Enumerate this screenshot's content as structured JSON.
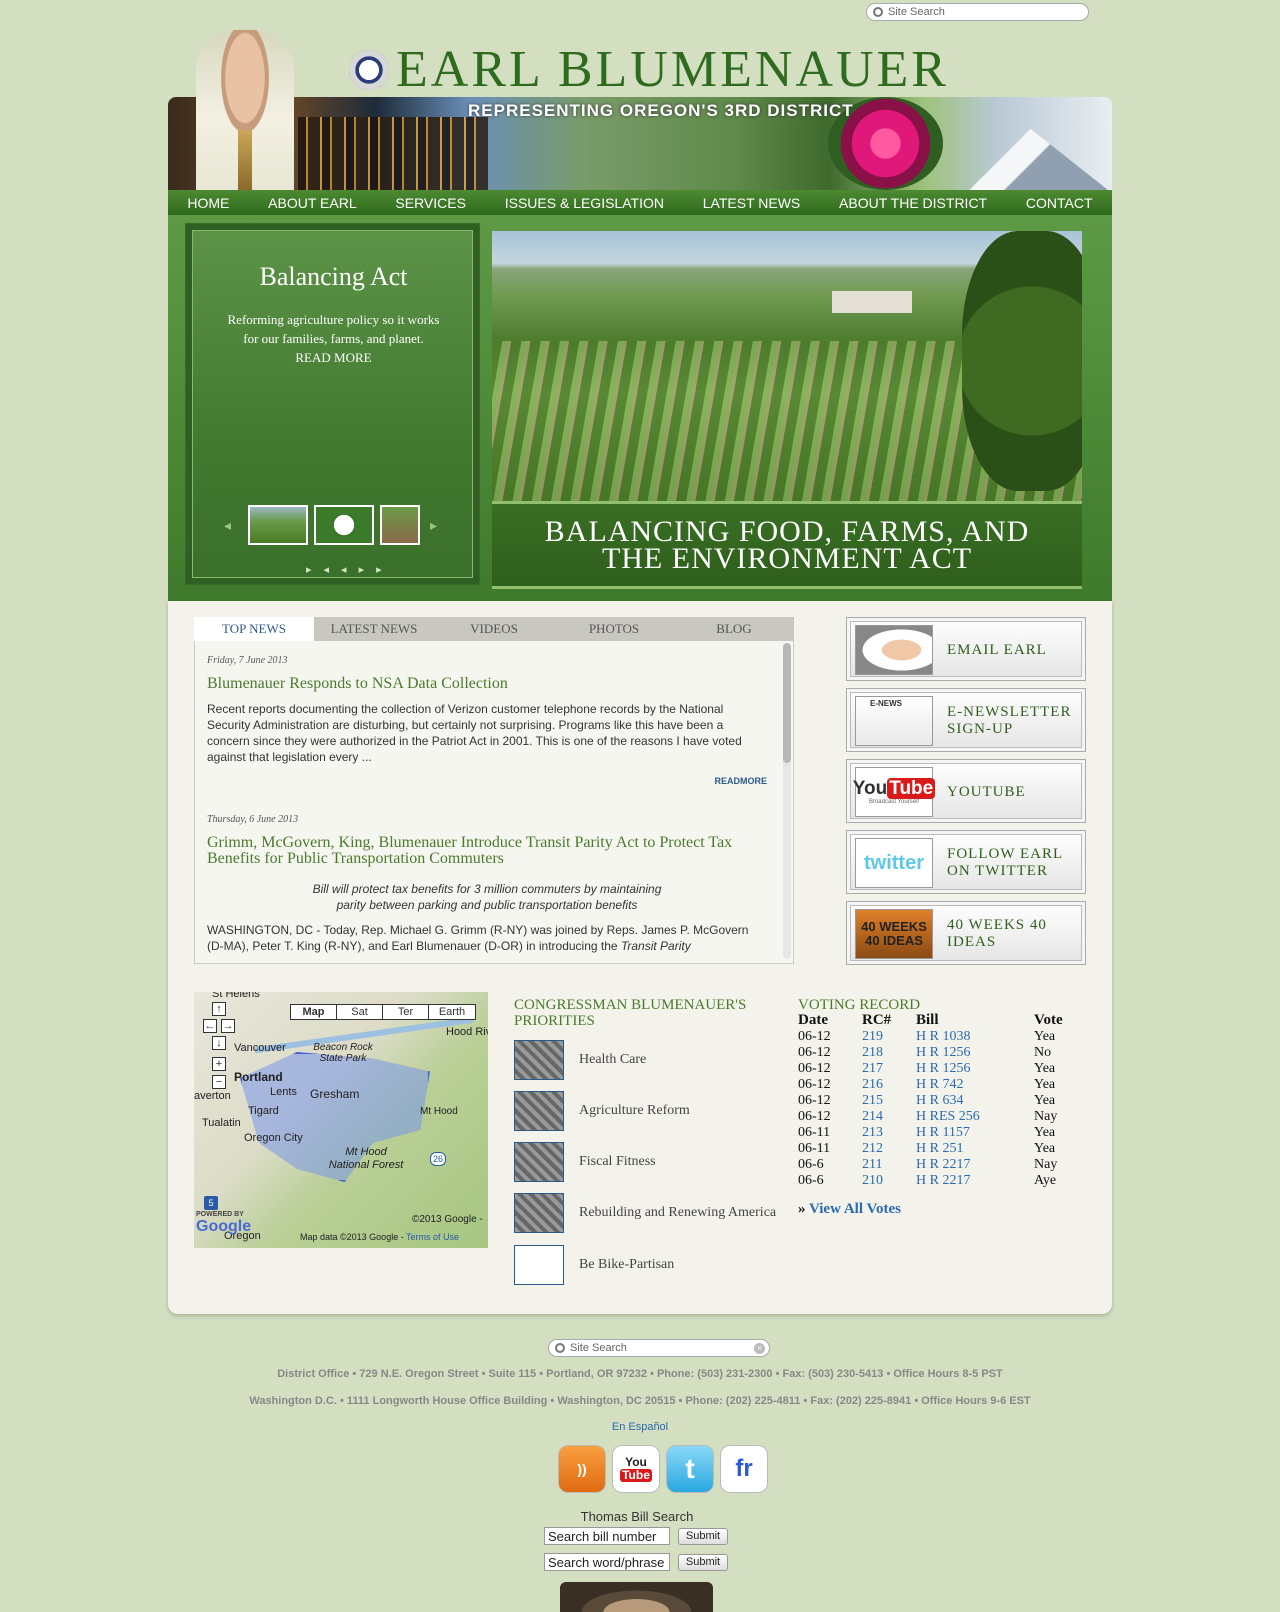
{
  "header": {
    "search_placeholder": "Site Search",
    "title": "EARL BLUMENAUER",
    "banner_text": "REPRESENTING OREGON'S 3RD DISTRICT"
  },
  "nav": [
    "HOME",
    "ABOUT EARL",
    "SERVICES",
    "ISSUES & LEGISLATION",
    "LATEST NEWS",
    "ABOUT THE DISTRICT",
    "CONTACT"
  ],
  "hero": {
    "feature_title": "Balancing Act",
    "feature_text": "Reforming agriculture policy so it works for our families, farms, and planet. READ MORE",
    "caption_line1": "BALANCING FOOD, FARMS, AND",
    "caption_line2": "THE ENVIRONMENT ACT"
  },
  "tabs": [
    "TOP NEWS",
    "LATEST NEWS",
    "VIDEOS",
    "PHOTOS",
    "BLOG"
  ],
  "news": [
    {
      "date": "Friday, 7 June 2013",
      "headline": "Blumenauer Responds to NSA Data Collection",
      "body": "Recent reports documenting the collection of Verizon customer telephone records by the National Security Administration are disturbing, but certainly not surprising. Programs like this have been a concern since they were authorized in the Patriot Act in 2001. This is one of the reasons I have voted against that legislation every ...",
      "more": "READMORE"
    },
    {
      "date": "Thursday, 6 June 2013",
      "headline": "Grimm, McGovern, King, Blumenauer Introduce Transit Parity Act to Protect Tax Benefits for Public Transportation Commuters",
      "subhead_line1": "Bill will protect tax benefits for 3 million commuters by maintaining",
      "subhead_line2": "parity between parking and public transportation benefits",
      "body": "WASHINGTON, DC - Today, Rep. Michael G. Grimm (R-NY) was joined by Reps. James P. McGovern (D-MA), Peter T. King (R-NY), and Earl Blumenauer (D-OR) in introducing the",
      "body_italic": "Transit Parity"
    }
  ],
  "side_buttons": [
    {
      "label": "EMAIL EARL",
      "icon": "typing-hands-icon"
    },
    {
      "label": "E-NEWSLETTER SIGN-UP",
      "icon": "newsletter-icon",
      "icon_text": "E-NEWS"
    },
    {
      "label": "YOUTUBE",
      "icon": "youtube-icon",
      "icon_text_1": "You",
      "icon_text_2": "Tube",
      "icon_text_3": "Broadcast Yourself"
    },
    {
      "label": "FOLLOW EARL ON TWITTER",
      "icon": "twitter-icon",
      "icon_text": "twitter"
    },
    {
      "label": "40 WEEKS 40 IDEAS",
      "icon": "forty-ideas-icon",
      "icon_text_1": "40 WEEKS",
      "icon_text_2": "40 IDEAS"
    }
  ],
  "map": {
    "buttons": [
      "Map",
      "Sat",
      "Ter",
      "Earth"
    ],
    "labels": [
      "St Helens",
      "Vancouver",
      "Hood Riv",
      "Beacon Rock State Park",
      "Portland",
      "Gresham",
      "averton",
      "Lents",
      "Tigard",
      "Mt Hood",
      "Tualatin",
      "Oregon City",
      "Mt Hood National Forest",
      "Oregon"
    ],
    "powered_by": "POWERED BY",
    "google": "Google",
    "copyright": "©2013 Google -",
    "map_data": "Map data ©2013 Google -",
    "terms": "Terms of Use",
    "highway_5": "5",
    "highway_26": "26"
  },
  "priorities": {
    "title": "CONGRESSMAN BLUMENAUER'S PRIORITIES",
    "items": [
      "Health Care",
      "Agriculture Reform",
      "Fiscal Fitness",
      "Rebuilding and Renewing America",
      "Be Bike-Partisan"
    ]
  },
  "voting": {
    "title": "VOTING RECORD",
    "headers": [
      "Date",
      "RC#",
      "Bill",
      "Vote"
    ],
    "rows": [
      [
        "06-12",
        "219",
        "H R 1038",
        "Yea"
      ],
      [
        "06-12",
        "218",
        "H R 1256",
        "No"
      ],
      [
        "06-12",
        "217",
        "H R 1256",
        "Yea"
      ],
      [
        "06-12",
        "216",
        "H R 742",
        "Yea"
      ],
      [
        "06-12",
        "215",
        "H R 634",
        "Yea"
      ],
      [
        "06-12",
        "214",
        "H RES 256",
        "Nay"
      ],
      [
        "06-11",
        "213",
        "H R 1157",
        "Yea"
      ],
      [
        "06-11",
        "212",
        "H R 251",
        "Yea"
      ],
      [
        "06-6",
        "211",
        "H R 2217",
        "Nay"
      ],
      [
        "06-6",
        "210",
        "H R 2217",
        "Aye"
      ]
    ],
    "view_all": "View All Votes",
    "view_all_prefix": "»"
  },
  "footer": {
    "search_placeholder": "Site Search",
    "district_office": "District Office • 729 N.E. Oregon Street • Suite 115 • Portland, OR 97232 • Phone: (503) 231-2300 • Fax: (503) 230-5413 • Office Hours 8-5 PST",
    "dc_office": "Washington D.C. • 1111 Longworth House Office Building • Washington, DC 20515 • Phone: (202) 225-4811 • Fax: (202) 225-8941 • Office Hours 9-6 EST",
    "espanol": "En Español",
    "thomas_title": "Thomas Bill Search",
    "bill_number_value": "Search bill number",
    "word_phrase_value": "Search word/phrase",
    "submit": "Submit"
  },
  "social_icons": [
    "rss-icon",
    "youtube-icon",
    "twitter-icon",
    "flickr-icon"
  ],
  "social_text": {
    "youtube_1": "You",
    "youtube_2": "Tube",
    "twitter": "t",
    "flickr": "fr"
  }
}
